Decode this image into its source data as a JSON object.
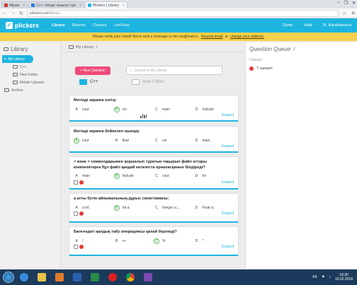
{
  "browser": {
    "tabs": [
      {
        "label": "Mipaw",
        "active": false
      },
      {
        "label": "C++ тілінде жазылу түрі",
        "active": false
      },
      {
        "label": "Plickers | Library",
        "active": true
      }
    ],
    "url_host": "plickers.com",
    "url_path": "/library",
    "window_controls": [
      "–",
      "❐",
      "✕"
    ]
  },
  "app": {
    "logo": "plickers",
    "nav": [
      "Library",
      "Reports",
      "Classes",
      "LiveView"
    ],
    "nav_right": [
      "Cards",
      "Help",
      "R. Karakhanova"
    ]
  },
  "verify": {
    "text": "Please verify your email! We've sent a message to rim-rus@mail.ru.",
    "resend": "Resend email",
    "or": "or",
    "change": "change your address."
  },
  "sidebar": {
    "title": "Library",
    "items": [
      {
        "label": "My Library",
        "active": true
      },
      {
        "label": "C++",
        "sub": true
      },
      {
        "label": "New Folder",
        "sub": true
      },
      {
        "label": "Mobile Uploads",
        "sub": true
      },
      {
        "label": "Archive",
        "sub": false
      }
    ]
  },
  "main": {
    "breadcrumb": "My Library",
    "new_question": "+ New Question",
    "search_placeholder": "Search in My Library",
    "folders": [
      "C++",
      "New Folder"
    ],
    "expand_label": "Expand",
    "questions": [
      {
        "text": "Мәтінді экранға енгізу",
        "options": [
          {
            "l": "A",
            "t": "cout"
          },
          {
            "l": "B",
            "t": "cin",
            "correct": true
          },
          {
            "l": "C",
            "t": "main"
          },
          {
            "l": "D",
            "t": "Include"
          }
        ],
        "queued": false
      },
      {
        "text": "Мәтінді экранға бейнелеп шығару",
        "options": [
          {
            "l": "A",
            "t": "cout",
            "correct": true
          },
          {
            "l": "B",
            "t": "float"
          },
          {
            "l": "C",
            "t": "cin"
          },
          {
            "l": "D",
            "t": "main"
          }
        ],
        "queued": false
      },
      {
        "text": "< және > символдарымен қоршалып тұратын тақырып файл аттары компиляторға бұл файл қандай каталогта орналасқанын білдіреді?",
        "options": [
          {
            "l": "A",
            "t": "main"
          },
          {
            "l": "B",
            "t": "Include",
            "correct": true
          },
          {
            "l": "C",
            "t": "cout"
          },
          {
            "l": "D",
            "t": "Int"
          }
        ],
        "queued": true
      },
      {
        "text": "a атты бүтін айнымалының дұрыс сипаттамасы:",
        "options": [
          {
            "l": "A",
            "t": "a int;"
          },
          {
            "l": "B",
            "t": "Int a;",
            "correct": true
          },
          {
            "l": "C",
            "t": "Integer a;..."
          },
          {
            "l": "D",
            "t": "Float a;"
          }
        ],
        "queued": true
      },
      {
        "text": "Бөлгендегі қалдық табу операциясы қалай беріледі?",
        "options": [
          {
            "l": "A",
            "t": "/"
          },
          {
            "l": "B",
            "t": "++"
          },
          {
            "l": "C",
            "t": "%",
            "correct": true
          },
          {
            "l": "D",
            "t": "^"
          }
        ],
        "queued": true
      }
    ]
  },
  "queue": {
    "title": "Question Queue",
    "classes_label": "Classes",
    "class_name": "7 сынып!"
  },
  "taskbar": {
    "lang": "KK",
    "time": "18:30",
    "date": "16.02.2018"
  }
}
